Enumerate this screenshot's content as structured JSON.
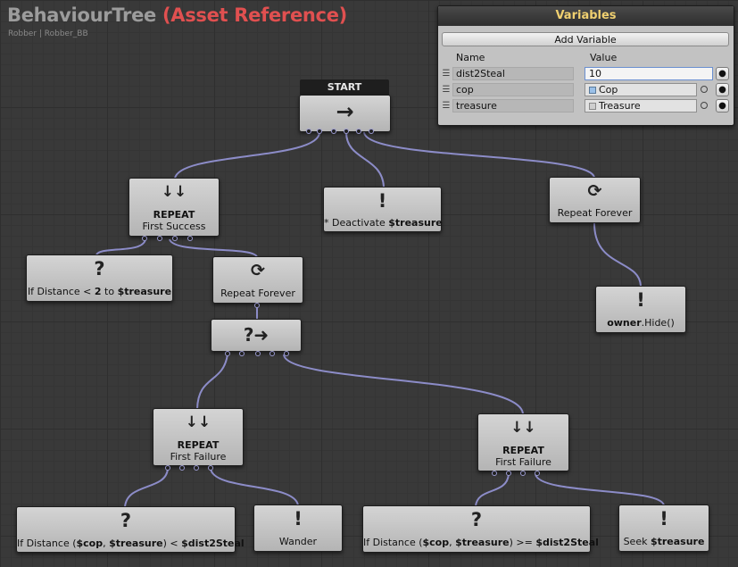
{
  "header": {
    "title": "BehaviourTree",
    "title_ref": "(Asset Reference)",
    "subtitle": "Robber | Robber_BB"
  },
  "variables": {
    "title": "Variables",
    "add_label": "Add Variable",
    "col_name": "Name",
    "col_value": "Value",
    "rows": [
      {
        "name": "dist2Steal",
        "value": "10"
      },
      {
        "name": "cop",
        "value": "Cop"
      },
      {
        "name": "treasure",
        "value": "Treasure"
      }
    ]
  },
  "nodes": {
    "start": {
      "label": "START",
      "icon": "→"
    },
    "repeat_success": {
      "icon": "↓↓",
      "title": "REPEAT",
      "sub": "First Success"
    },
    "deactivate": {
      "icon": "!",
      "pre": "* Deactivate ",
      "var": "$treasure"
    },
    "repeat_forever_top": {
      "icon": "⟳",
      "label": "Repeat Forever"
    },
    "condition_distance": {
      "icon": "?",
      "pre": "If Distance < ",
      "num": "2",
      "mid": " to ",
      "var": "$treasure"
    },
    "repeat_forever_mid": {
      "icon": "⟳",
      "label": "Repeat Forever"
    },
    "owner_hide": {
      "icon": "!",
      "owner": "owner",
      "call": ".Hide()"
    },
    "selector": {
      "icon": "?➜"
    },
    "repeat_failure_left": {
      "icon": "↓↓",
      "title": "REPEAT",
      "sub": "First Failure"
    },
    "repeat_failure_right": {
      "icon": "↓↓",
      "title": "REPEAT",
      "sub": "First Failure"
    },
    "cond_less": {
      "icon": "?",
      "pre": "If Distance (",
      "a": "$cop",
      "sep": ", ",
      "b": "$treasure",
      "op": ")  <  ",
      "c": "$dist2Steal"
    },
    "wander": {
      "icon": "!",
      "label": "Wander"
    },
    "cond_geq": {
      "icon": "?",
      "pre": "If Distance (",
      "a": "$cop",
      "sep": ", ",
      "b": "$treasure",
      "op": ")  >=  ",
      "c": "$dist2Steal"
    },
    "seek": {
      "icon": "!",
      "pre": "Seek ",
      "var": "$treasure"
    }
  },
  "colors": {
    "wire": "#8c8cc8",
    "ref": "#e05050",
    "vars_title": "#f0d070"
  }
}
